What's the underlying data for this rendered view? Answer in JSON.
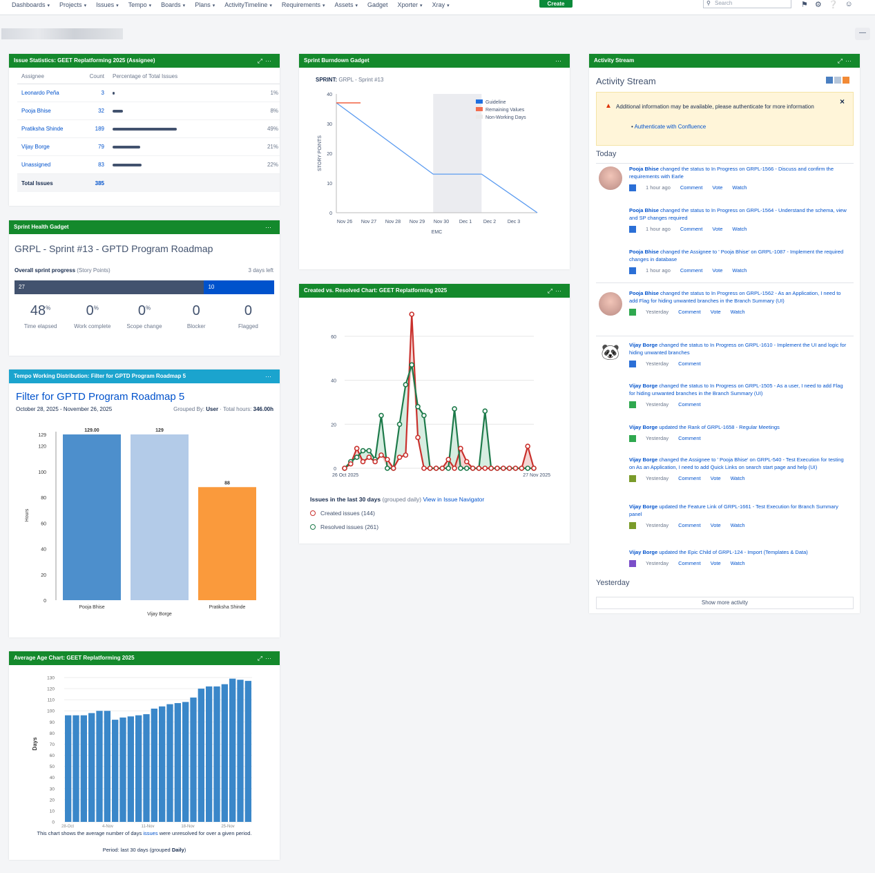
{
  "nav": {
    "items": [
      "Dashboards",
      "Projects",
      "Issues",
      "Tempo",
      "Boards",
      "Plans",
      "ActivityTimeline",
      "Requirements",
      "Assets",
      "Gadget",
      "Xporter",
      "Xray"
    ],
    "create_label": "Create",
    "search_placeholder": "Search"
  },
  "colors": {
    "jira_green": "#14892c",
    "tempo_blue": "#1ba4ce",
    "link": "#0052cc",
    "created": "#c9302c",
    "resolved": "#1d7a4a"
  },
  "issue_stats": {
    "title": "Issue Statistics: GEET Replatforming 2025 (Assignee)",
    "headers": [
      "Assignee",
      "Count",
      "Percentage of Total Issues"
    ],
    "rows": [
      {
        "name": "Leonardo Peña",
        "count": "3",
        "pct": "1%",
        "frac": 0.01
      },
      {
        "name": "Pooja Bhise",
        "count": "32",
        "pct": "8%",
        "frac": 0.08
      },
      {
        "name": "Pratiksha Shinde",
        "count": "189",
        "pct": "49%",
        "frac": 0.49
      },
      {
        "name": "Vijay Borge",
        "count": "79",
        "pct": "21%",
        "frac": 0.21
      },
      {
        "name": "Unassigned",
        "count": "83",
        "pct": "22%",
        "frac": 0.22
      }
    ],
    "total_label": "Total Issues",
    "total_value": "385"
  },
  "sprint_health": {
    "title": "Sprint Health Gadget",
    "sprint_name": "GRPL - Sprint #13 - GPTD Program Roadmap",
    "progress_label": "Overall sprint progress",
    "progress_unit": "(Story Points)",
    "days_left": "3 days left",
    "done": "27",
    "todo": "10",
    "done_frac": 0.73,
    "stats": [
      {
        "value": "48",
        "suffix": "%",
        "label": "Time elapsed"
      },
      {
        "value": "0",
        "suffix": "%",
        "label": "Work complete"
      },
      {
        "value": "0",
        "suffix": "%",
        "label": "Scope change"
      },
      {
        "value": "0",
        "suffix": "",
        "label": "Blocker"
      },
      {
        "value": "0",
        "suffix": "",
        "label": "Flagged"
      }
    ]
  },
  "tempo": {
    "title": "Tempo Working Distribution: Filter for GPTD Program Roadmap 5",
    "filter_title": "Filter for GPTD Program Roadmap 5",
    "dates": "October 28, 2025 - November 26, 2025",
    "group_prefix": "Grouped By:",
    "group_value": "User",
    "total_prefix": "Total hours:",
    "total_value": "346.00h"
  },
  "burndown": {
    "title": "Sprint Burndown Gadget",
    "sprint_label": "SPRINT:",
    "sprint_value": "GRPL - Sprint #13"
  },
  "cvr": {
    "title": "Created vs. Resolved Chart: GEET Replatforming 2025",
    "footer_bold": "Issues in the last 30 days",
    "footer_rest": "(grouped daily)",
    "footer_link": "View in Issue Navigator",
    "created_label": "Created issues (144)",
    "resolved_label": "Resolved issues (261)"
  },
  "avgage": {
    "title": "Average Age Chart: GEET Replatforming 2025",
    "caption_pre": "This chart shows the average number of days",
    "caption_link": "issues",
    "caption_post": "were unresolved for over a given period.",
    "period_pre": "Period: last 30 days (grouped",
    "period_bold": "Daily",
    "period_post": ")"
  },
  "activity": {
    "title": "Activity Stream",
    "warning": "Additional information may be available, please authenticate for more information",
    "auth_link": "Authenticate with Confluence",
    "today": "Today",
    "yesterday": "Yesterday",
    "show_more": "Show more activity",
    "entries": [
      {
        "who": "Pooja Bhise",
        "text": "changed the status to In Progress on GRPL-1566 - Discuss and confirm the requirements with Earle",
        "time": "1 hour ago",
        "actions": [
          "Comment",
          "Vote",
          "Watch"
        ]
      },
      {
        "who": "Pooja Bhise",
        "text": "changed the status to In Progress on GRPL-1564 - Understand the schema, view and SP changes required",
        "time": "1 hour ago",
        "actions": [
          "Comment",
          "Vote",
          "Watch"
        ]
      },
      {
        "who": "Pooja Bhise",
        "text": "changed the Assignee to ' Pooja Bhise' on GRPL-1087 - Implement the required changes in database",
        "time": "1 hour ago",
        "actions": [
          "Comment",
          "Vote",
          "Watch"
        ]
      },
      {
        "who": "Pooja Bhise",
        "text": "changed the status to In Progress on GRPL-1562 - As an Application, I need to add Flag for hiding unwanted branches in the Branch Summary (UI)",
        "time": "Yesterday",
        "actions": [
          "Comment",
          "Vote",
          "Watch"
        ]
      },
      {
        "who": "Vijay Borge",
        "text": "changed the status to In Progress on GRPL-1610 - Implement the UI and logic for hiding unwanted branches",
        "time": "Yesterday",
        "actions": [
          "Comment"
        ]
      },
      {
        "who": "Vijay Borge",
        "text": "changed the status to In Progress on GRPL-1505 - As a user, I need to add Flag for hiding unwanted branches in the Branch Summary (UI)",
        "time": "Yesterday",
        "actions": [
          "Comment"
        ]
      },
      {
        "who": "Vijay Borge",
        "text": "updated the Rank of GRPL-1658 - Regular Meetings",
        "time": "Yesterday",
        "actions": [
          "Comment"
        ]
      },
      {
        "who": "Vijay Borge",
        "text": "changed the Assignee to ' Pooja Bhise' on GRPL-540 - Test Execution for testing on As an Application, I need to add Quick Links on search start page and help (UI)",
        "time": "Yesterday",
        "actions": [
          "Comment",
          "Vote",
          "Watch"
        ]
      },
      {
        "who": "Vijay Borge",
        "text": "updated the Feature Link of GRPL-1661 - Test Execution for Branch Summary panel",
        "time": "Yesterday",
        "actions": [
          "Comment",
          "Vote",
          "Watch"
        ]
      },
      {
        "who": "Vijay Borge",
        "text": "updated the Epic Child of GRPL-124 - Import (Templates & Data)",
        "time": "Yesterday",
        "actions": [
          "Comment",
          "Vote",
          "Watch"
        ]
      }
    ]
  },
  "chart_data": [
    {
      "type": "line",
      "title": "Sprint Burndown Gadget",
      "xlabel": "EMC",
      "ylabel": "STORY POINTS",
      "categories": [
        "Nov 26",
        "Nov 27",
        "Nov 28",
        "Nov 29",
        "Nov 30",
        "Dec 1",
        "Dec 2",
        "Dec 3"
      ],
      "ylim": [
        0,
        40
      ],
      "yticks": [
        0,
        10,
        20,
        30,
        40
      ],
      "legend": [
        "Guideline",
        "Remaining Values",
        "Non-Working Days"
      ],
      "series": [
        {
          "name": "Guideline",
          "color": "#5b9bf0",
          "points": [
            [
              0,
              37
            ],
            [
              4,
              13
            ],
            [
              6,
              13
            ],
            [
              8.3,
              0
            ]
          ]
        },
        {
          "name": "Remaining Values",
          "color": "#f26d4f",
          "points": [
            [
              0,
              37
            ],
            [
              1,
              37
            ]
          ]
        }
      ],
      "non_working": [
        4,
        6
      ]
    },
    {
      "type": "line",
      "title": "Created vs. Resolved Chart: GEET Replatforming 2025",
      "x_start": "26 Oct 2025",
      "x_end": "27 Nov 2025",
      "ylim": [
        0,
        70
      ],
      "yticks": [
        0,
        20,
        40,
        60
      ],
      "series": [
        {
          "name": "Created issues (144)",
          "color": "#c9302c",
          "values": [
            0,
            2,
            9,
            3,
            5,
            3,
            6,
            4,
            0,
            5,
            6,
            70,
            14,
            0,
            0,
            0,
            0,
            4,
            0,
            9,
            3,
            0,
            0,
            0,
            0,
            0,
            0,
            0,
            0,
            0,
            10,
            0
          ]
        },
        {
          "name": "Resolved issues (261)",
          "color": "#1d7a4a",
          "values": [
            0,
            3,
            5,
            8,
            8,
            4,
            24,
            0,
            0,
            20,
            38,
            47,
            28,
            24,
            0,
            0,
            0,
            0,
            27,
            0,
            0,
            0,
            0,
            26,
            0,
            0,
            0,
            0,
            0,
            0,
            0,
            0
          ]
        }
      ]
    },
    {
      "type": "bar",
      "title": "Filter for GPTD Program Roadmap 5",
      "ylabel": "Hours",
      "categories": [
        "Pooja Bhise",
        "Vijay Borge",
        "Pratiksha Shinde"
      ],
      "values": [
        129,
        129,
        88
      ],
      "labels": [
        "129.00",
        "129",
        "88"
      ],
      "colors": [
        "#4d8fcc",
        "#b3cbe8",
        "#fa9a3c"
      ],
      "ylim": [
        0,
        129
      ],
      "yticks": [
        0,
        20,
        40,
        60,
        80,
        100,
        120,
        129
      ]
    },
    {
      "type": "bar",
      "title": "Average Age Chart: GEET Replatforming 2025",
      "ylabel": "Days",
      "ylim": [
        0,
        130
      ],
      "yticks": [
        0,
        10,
        20,
        30,
        40,
        50,
        60,
        70,
        80,
        90,
        100,
        110,
        120,
        130
      ],
      "xticks": [
        "28-Oct",
        "4-Nov",
        "11-Nov",
        "18-Nov",
        "25-Nov"
      ],
      "values": [
        96,
        96,
        96,
        98,
        100,
        100,
        92,
        94,
        95,
        96,
        97,
        102,
        104,
        106,
        107,
        108,
        112,
        120,
        122,
        122,
        124,
        129,
        128,
        127
      ]
    }
  ]
}
